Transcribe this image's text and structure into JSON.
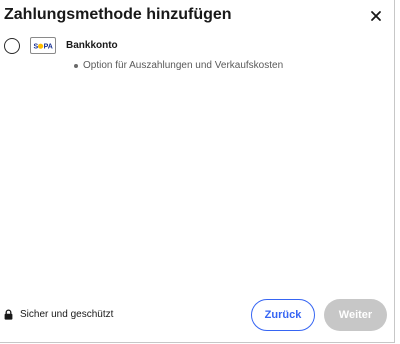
{
  "dialog": {
    "title": "Zahlungsmethode hinzufügen",
    "close_icon": "close-icon"
  },
  "payment_option": {
    "selected": false,
    "logo_icon": "sepa-logo-icon",
    "logo_text": "SEPA",
    "name": "Bankkonto",
    "details": [
      "Option für Auszahlungen und Verkaufskosten"
    ]
  },
  "footer": {
    "secure_icon": "lock-icon",
    "secure_text": "Sicher und geschützt",
    "back_label": "Zurück",
    "next_label": "Weiter",
    "next_enabled": false
  },
  "colors": {
    "accent": "#3665f3",
    "disabled_button": "#c7c7c7",
    "text": "#191919",
    "muted_text": "#5a5a5a",
    "sepa_blue": "#10298e",
    "sepa_yellow": "#ffbe00"
  }
}
